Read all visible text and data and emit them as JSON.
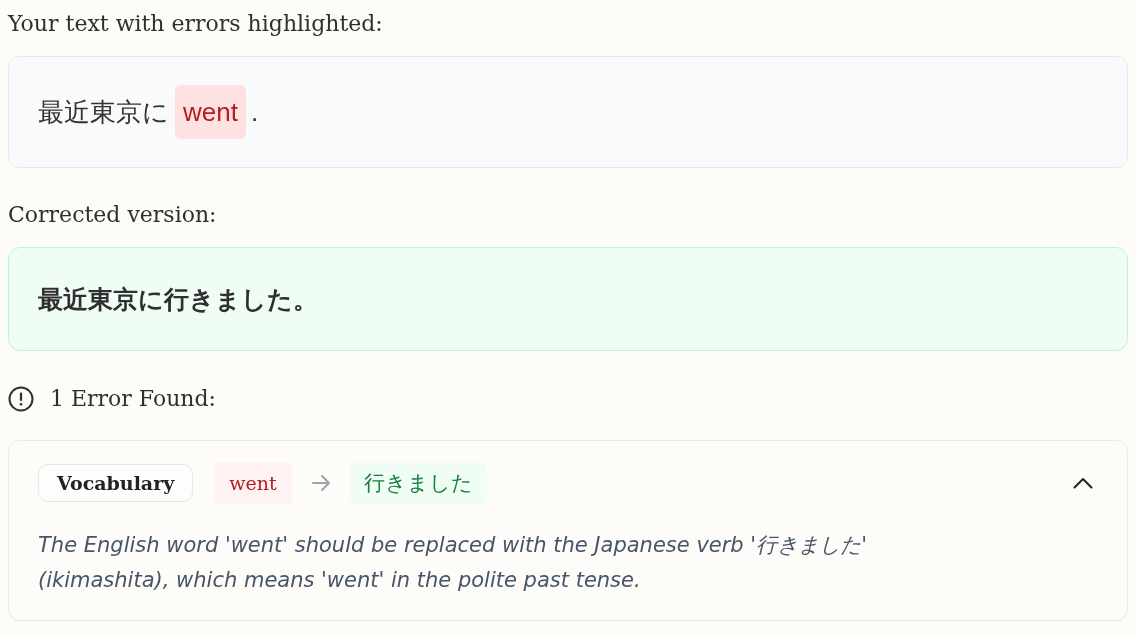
{
  "input_section": {
    "label": "Your text with errors highlighted:",
    "segments": [
      {
        "kind": "text",
        "text": "最近東京に"
      },
      {
        "kind": "error",
        "text": "went"
      },
      {
        "kind": "text",
        "text": "."
      }
    ]
  },
  "corrected_section": {
    "label": "Corrected version:",
    "text": "最近東京に行きました。"
  },
  "errors_summary": {
    "label": "1 Error Found:"
  },
  "errors": [
    {
      "category": "Vocabulary",
      "original": "went",
      "correction": "行きました",
      "expanded": true,
      "explanation": "The English word 'went' should be replaced with the Japanese verb '行きました' (ikimashita), which means 'went' in the polite past tense."
    }
  ]
}
